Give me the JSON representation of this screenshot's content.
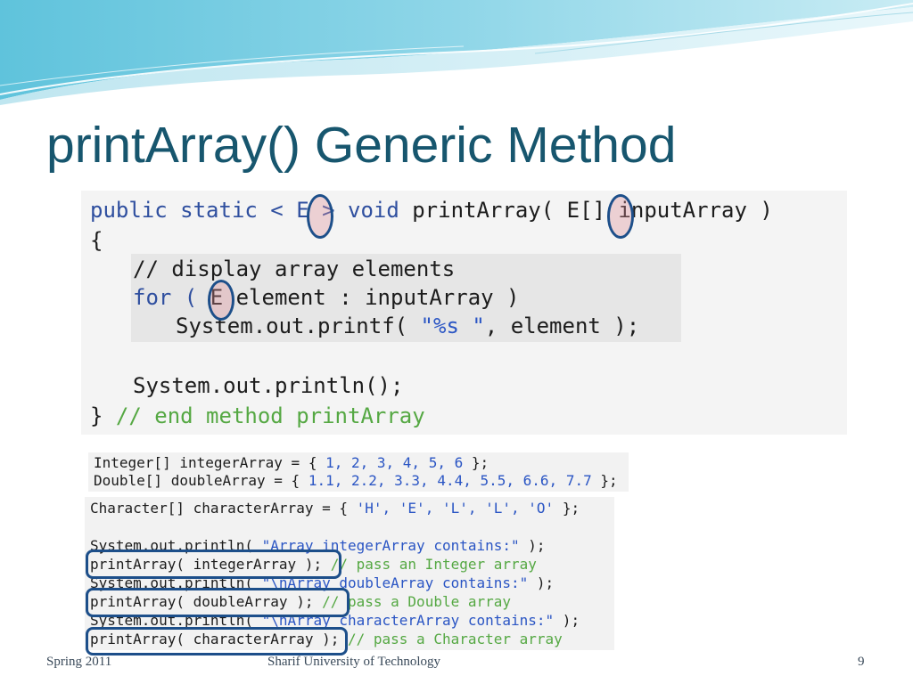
{
  "slide": {
    "title": "printArray() Generic Method",
    "footer_left": "Spring 2011",
    "footer_center": "Sharif University of Technology",
    "page_number": "9"
  },
  "code_top": {
    "l1_a": "public static < ",
    "l1_e1": "E",
    "l1_b": " > void ",
    "l1_c": "printArray( ",
    "l1_e2": "E",
    "l1_d": "[] inputArray )",
    "l2": "{",
    "l3": "// display array elements",
    "l4_a": "for ( ",
    "l4_e": "E",
    "l4_b": " element : inputArray )",
    "l5_a": "System.out.printf( ",
    "l5_s": "\"%s \"",
    "l5_b": ", element );",
    "l6": "System.out.println();",
    "l7_a": "} ",
    "l7_c": "// end method printArray"
  },
  "code_bottom": {
    "int_a": "Integer[] integerArray = { ",
    "int_v": "1, 2, 3, 4, 5, 6",
    "int_b": " };",
    "dbl_a": "Double[] doubleArray = { ",
    "dbl_v": "1.1, 2.2, 3.3, 4.4, 5.5, 6.6, 7.7",
    "dbl_b": " };",
    "chr_a": "Character[] characterArray = { ",
    "chr_v": "'H', 'E', 'L', 'L', 'O'",
    "chr_b": " };",
    "p1_a": "System.out.println( ",
    "p1_s": "\"Array integerArray contains:\"",
    "p1_b": " );",
    "c1_a": "printArray( integerArray ); ",
    "c1_c": "// pass an Integer array",
    "p2_a": "System.out.println( ",
    "p2_s": "\"\\nArray doubleArray contains:\"",
    "p2_b": " );",
    "c2_a": "printArray( doubleArray ); ",
    "c2_c": "// pass a Double array",
    "p3_a": "System.out.println( ",
    "p3_s": "\"\\nArray characterArray contains:\"",
    "p3_b": " );",
    "c3_a": "printArray( characterArray ); ",
    "c3_c": "// pass a Character array"
  },
  "colors": {
    "title": "#17566e",
    "keyword": "#2f4f9f",
    "comment": "#55a843",
    "string": "#2a55c4",
    "highlight_ring": "#1d4f8a"
  }
}
